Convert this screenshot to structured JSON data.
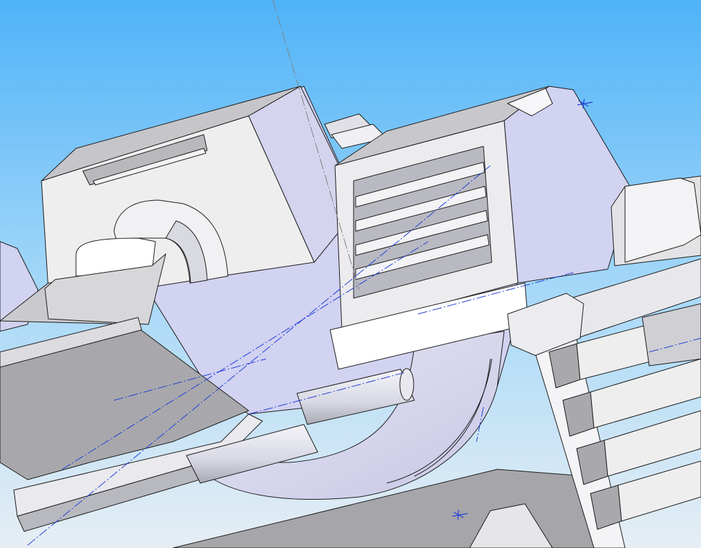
{
  "view": {
    "type": "cad-3d-viewport",
    "background_gradient": [
      "#4fb3f8",
      "#a9d9f8",
      "#e6eef4"
    ],
    "face_colors": {
      "light": "#f1f1f7",
      "lavender": "#d2d2f1",
      "mid": "#c8c8cc",
      "dark": "#a9a9ad",
      "shadow": "#8f8f96"
    },
    "edge_color": "#1a1a1a",
    "centerline_color": "#1f3fd6",
    "axis_line_color": "#808080"
  }
}
